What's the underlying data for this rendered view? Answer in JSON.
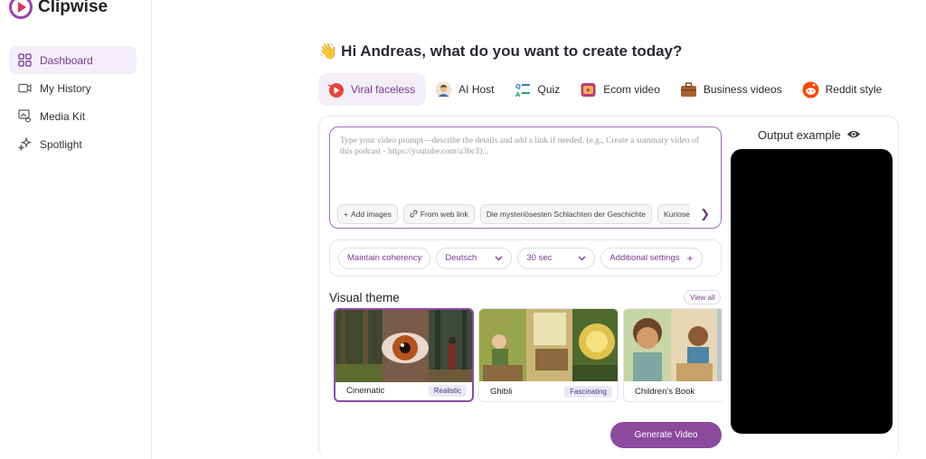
{
  "app": {
    "name": "Clipwise"
  },
  "sidebar": {
    "items": [
      {
        "label": "Dashboard",
        "icon": "grid-icon",
        "active": true
      },
      {
        "label": "My History",
        "icon": "video-camera-icon",
        "active": false
      },
      {
        "label": "Media Kit",
        "icon": "media-icon",
        "active": false
      },
      {
        "label": "Spotlight",
        "icon": "sparkle-icon",
        "active": false
      }
    ]
  },
  "main": {
    "greeting_emoji": "👋",
    "greeting": "Hi Andreas, what do you want to create today?",
    "tabs": [
      {
        "label": "Viral faceless",
        "icon": "play-burst-icon",
        "active": true
      },
      {
        "label": "AI Host",
        "icon": "avatar-icon",
        "active": false
      },
      {
        "label": "Quiz",
        "icon": "quiz-icon",
        "active": false
      },
      {
        "label": "Ecom video",
        "icon": "ecom-icon",
        "active": false
      },
      {
        "label": "Business videos",
        "icon": "briefcase-icon",
        "active": false
      },
      {
        "label": "Reddit style",
        "icon": "reddit-icon",
        "active": false
      }
    ],
    "prompt": {
      "placeholder": "Type your video prompt—describe the details and add a link if needed. (e.g., Create a summary video of this podcast - https://youtube.com/a3bc3)...",
      "chips": [
        {
          "label": "Add images",
          "prefix": "+"
        },
        {
          "label": "From web link",
          "prefix": "🔗"
        },
        {
          "label": "Die mysteriösesten Schlachten der Geschichte",
          "prefix": ""
        },
        {
          "label": "Kurioses",
          "prefix": ""
        }
      ]
    },
    "settings": {
      "coherency": "Maintain coherency",
      "language": "Deutsch",
      "duration": "30 sec",
      "additional": "Additional settings"
    },
    "visual_theme": {
      "title": "Visual theme",
      "view_all": "View all",
      "cards": [
        {
          "name": "Cinematic",
          "tag": "Realistic",
          "selected": true
        },
        {
          "name": "Ghibli",
          "tag": "Fascinating",
          "selected": false
        },
        {
          "name": "Children's Book",
          "tag": "",
          "selected": false
        }
      ]
    },
    "generate_label": "Generate Video"
  },
  "output": {
    "title": "Output example"
  },
  "colors": {
    "accent": "#8b4a9c",
    "accent_light": "#f3eef7",
    "video_bg": "#000000"
  }
}
